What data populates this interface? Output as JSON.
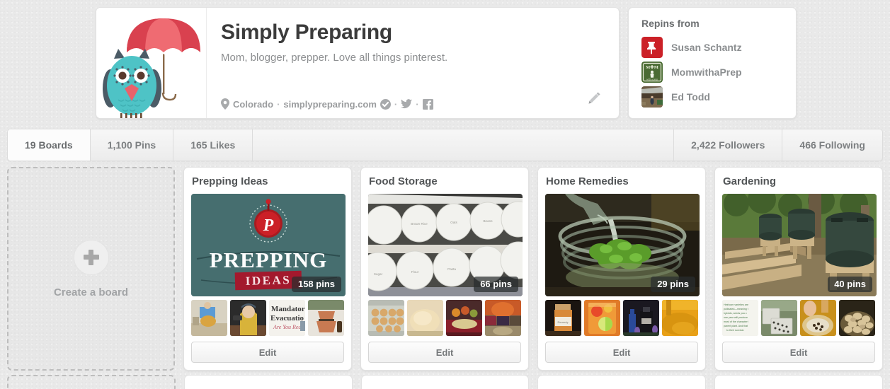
{
  "profile": {
    "name": "Simply Preparing",
    "about": "Mom, blogger, prepper. Love all things pinterest.",
    "location": "Colorado",
    "website": "simplypreparing.com",
    "separator": "·",
    "avatar_icon": "owl-with-umbrella-avatar",
    "verified_icon": "verified-checkmark-icon",
    "twitter_icon": "twitter-bird-icon",
    "facebook_icon": "facebook-icon",
    "location_icon": "map-pin-icon",
    "edit_icon": "pencil-edit-icon"
  },
  "repins": {
    "title": "Repins from",
    "users": [
      {
        "name": "Susan Schantz",
        "avatar_icon": "red-pushpin-avatar"
      },
      {
        "name": "MomwithaPrep",
        "avatar_icon": "green-mom-sign-avatar"
      },
      {
        "name": "Ed Todd",
        "avatar_icon": "photo-avatar"
      }
    ]
  },
  "stats": {
    "left_tabs": [
      {
        "label": "19 Boards",
        "active": true
      },
      {
        "label": "1,100 Pins",
        "active": false
      },
      {
        "label": "165 Likes",
        "active": false
      }
    ],
    "right_tabs": [
      {
        "label": "2,422 Followers"
      },
      {
        "label": "466 Following"
      }
    ]
  },
  "create_board": {
    "label": "Create a board",
    "icon": "plus-icon"
  },
  "boards": [
    {
      "title": "Prepping Ideas",
      "pins_label": "158 pins",
      "edit_label": "Edit",
      "cover": "prepping-ideas-cover",
      "cover_text_line1": "PREPPING",
      "cover_text_line2": "IDEAS",
      "thumbs": [
        "thumb-person-kneeling",
        "thumb-boy-with-drill",
        "thumb-mandatory-evacuation-sign",
        "thumb-clay-pot-heater"
      ]
    },
    {
      "title": "Food Storage",
      "pins_label": "66 pins",
      "edit_label": "Edit",
      "cover": "food-storage-containers-cover",
      "thumbs": [
        "thumb-egg-carton",
        "thumb-bread-dough",
        "thumb-canned-goods",
        "thumb-pumpkin-collage"
      ]
    },
    {
      "title": "Home Remedies",
      "pins_label": "29 pins",
      "edit_label": "Edit",
      "cover": "herbal-infusion-jar-cover",
      "thumbs": [
        "thumb-labeled-jar",
        "thumb-citrus-drink",
        "thumb-blue-bottles",
        "thumb-turmeric-powder"
      ]
    },
    {
      "title": "Gardening",
      "pins_label": "40 pins",
      "edit_label": "Edit",
      "cover": "rain-barrels-raised-beds-cover",
      "thumbs": [
        "thumb-heirloom-text",
        "thumb-seed-trays",
        "thumb-seeds-in-bowl",
        "thumb-potato-harvest"
      ]
    }
  ],
  "colors": {
    "page_background": "#e9e9e9",
    "card_background": "#ffffff",
    "text_primary": "#3b3b3b",
    "text_secondary": "#8d8f91",
    "pinterest_red": "#cb2027",
    "avatar_teal": "#4ec3c6",
    "avatar_coral": "#e8626b"
  }
}
